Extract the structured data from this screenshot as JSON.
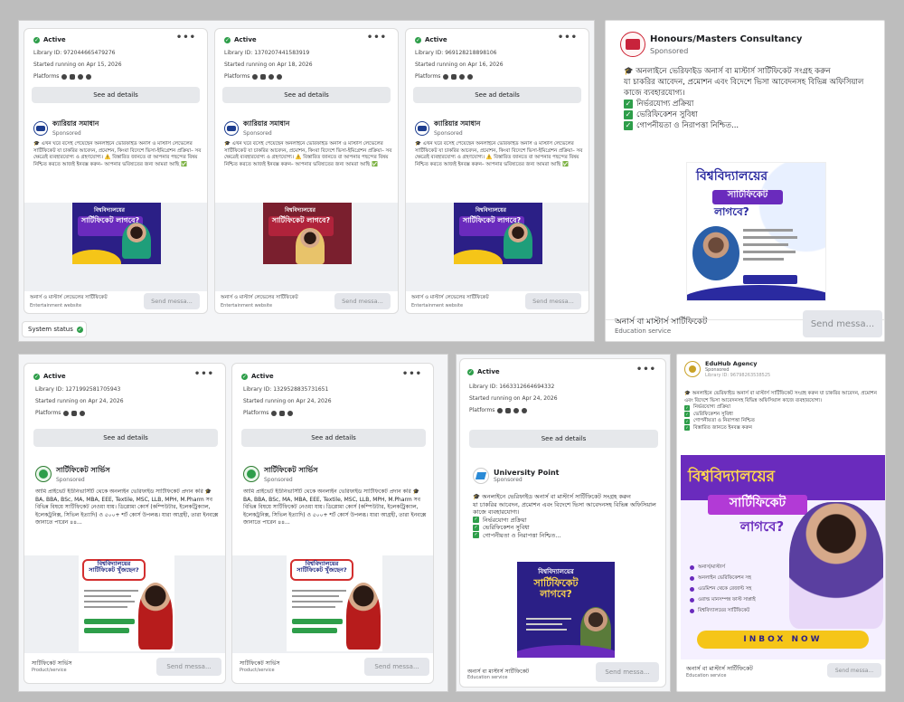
{
  "top_panel_cards": [
    {
      "status": "Active",
      "library_id": "Library ID: 972044665479276",
      "started": "Started running on Apr 15, 2026",
      "platforms_label": "Platforms",
      "see_details": "See ad details",
      "advertiser": "ক্যারিয়ার সমাধান",
      "sponsored": "Sponsored",
      "body": "🎓 এখন ঘরে বসেই পেয়েছেন অনলাইনে ভেরিফাইড অনার্স ও মাস্টার্স লেভেলের সার্টিফিকেট যা চাকরির আবেদন, প্রমোশন, কিংবা বিদেশে ভিসা-ইমিগ্রেশন প্রক্রিয়া– সব ক্ষেত্রেই ব্যবহারযোগ্য ও গ্রহণযোগ্য। ⚠️ বিস্তারিত জানতে বা আপনার পছন্দের বিষয় নিশ্চিত করতে আজই ইনবক্স করুন– আপনার ভবিষ্যতের জন্য আমরা আছি ✅",
      "creative_title": "সার্টিফিকেট লাগবে?",
      "creative_kicker": "বিশ্ববিদ্যালয়ের",
      "footer_label": "অনার্স ও মাস্টার্স লেভেলের সার্টিফিকেট",
      "footer_sub": "Entertainment website",
      "send": "Send messa..."
    },
    {
      "status": "Active",
      "library_id": "Library ID: 1370207441583919",
      "started": "Started running on Apr 18, 2026",
      "platforms_label": "Platforms",
      "see_details": "See ad details",
      "advertiser": "ক্যারিয়ার সমাধান",
      "sponsored": "Sponsored",
      "body": "🎓 এখন ঘরে বসেই পেয়েছেন অনলাইনে ভেরিফাইড অনার্স ও মাস্টার্স লেভেলের সার্টিফিকেট যা চাকরির আবেদন, প্রমোশন, কিংবা বিদেশে ভিসা-ইমিগ্রেশন প্রক্রিয়া– সব ক্ষেত্রেই ব্যবহারযোগ্য ও গ্রহণযোগ্য। ⚠️ বিস্তারিত জানতে বা আপনার পছন্দের বিষয় নিশ্চিত করতে আজই ইনবক্স করুন– আপনার ভবিষ্যতের জন্য আমরা আছি ✅",
      "creative_title": "সার্টিফিকেট লাগবে?",
      "creative_kicker": "বিশ্ববিদ্যালয়ের",
      "footer_label": "অনার্স ও মাস্টার্স লেভেলের সার্টিফিকেট",
      "footer_sub": "Entertainment website",
      "send": "Send messa..."
    },
    {
      "status": "Active",
      "library_id": "Library ID: 969128218898106",
      "started": "Started running on Apr 16, 2026",
      "platforms_label": "Platforms",
      "see_details": "See ad details",
      "advertiser": "ক্যারিয়ার সমাধান",
      "sponsored": "Sponsored",
      "body": "🎓 এখন ঘরে বসেই পেয়েছেন অনলাইনে ভেরিফাইড অনার্স ও মাস্টার্স লেভেলের সার্টিফিকেট যা চাকরির আবেদন, প্রমোশন, কিংবা বিদেশে ভিসা-ইমিগ্রেশন প্রক্রিয়া– সব ক্ষেত্রেই ব্যবহারযোগ্য ও গ্রহণযোগ্য। ⚠️ বিস্তারিত জানতে বা আপনার পছন্দের বিষয় নিশ্চিত করতে আজই ইনবক্স করুন– আপনার ভবিষ্যতের জন্য আমরা আছি ✅",
      "creative_title": "সার্টিফিকেট লাগবে?",
      "creative_kicker": "বিশ্ববিদ্যালয়ের",
      "footer_label": "অনার্স ও মাস্টার্স লেভেলের সার্টিফিকেট",
      "footer_sub": "Entertainment website",
      "send": "Send messa..."
    }
  ],
  "system_status": "System status",
  "large_ad": {
    "advertiser": "Honours/Masters Consultancy",
    "sponsored": "Sponsored",
    "body_line1": "🎓 অনলাইনে ভেরিফাইড অনার্স বা মাস্টার্স সার্টিফিকেট সংগ্রহ করুন",
    "body_line2": "যা চাকরির আবেদন, প্রমোশন এবং বিদেশে ভিসা আবেদনসহ বিভিন্ন অফিসিয়াল কাজে ব্যবহারযোগ্য।",
    "checks": [
      "নির্ভরযোগ্য প্রক্রিয়া",
      "ভেরিফিকেশন সুবিধা",
      "গোপনীয়তা ও নিরাপত্তা নিশ্চিত..."
    ],
    "creative_title1": "বিশ্ববিদ্যালয়ের",
    "creative_title2": "সার্টিফিকেট",
    "creative_title3": "লাগবে?",
    "footer_label": "অনার্স বা মাস্টার্স সার্টিফিকেট",
    "footer_sub": "Education service",
    "send": "Send messa..."
  },
  "bottom_cards": [
    {
      "status": "Active",
      "library_id": "Library ID: 1271992581705943",
      "started": "Started running on Apr 24, 2026",
      "platforms_label": "Platforms",
      "see_details": "See ad details",
      "advertiser": "সার্টিফিকেট সার্ভিস",
      "sponsored": "Sponsored",
      "body": "আমি প্রাইভেট ইউনিভার্সিটি থেকে অনলাইন ভেরিফাইড সার্টিফিকেট প্রদান করি 🎓 BA, BBA, BSc, MA, MBA, EEE, Textile, MSC, LLB, MPH, M.Pharm সব বিভিন্ন বিষয়ে সার্টিফিকেট নেওয়া যায়। ডিপ্লোমা কোর্স (কম্পিউটার, ইলেকট্রিক্যাল, ইলেকট্রনিক্স, সিভিল ইত্যাদি) ও ৫০০+ শর্ট কোর্স উপলব্ধ। যারা আগ্রহী, তারা ইনবক্সে জানাতে পারেন ৪৪...",
      "creative_title": "বিশ্ববিদ্যালয়ের সার্টিফিকেট খুঁজছেন?",
      "footer_label": "সার্টিফিকেট সার্ভিস",
      "footer_sub": "Product/service",
      "send": "Send messa..."
    },
    {
      "status": "Active",
      "library_id": "Library ID: 1329528835731651",
      "started": "Started running on Apr 24, 2026",
      "platforms_label": "Platforms",
      "see_details": "See ad details",
      "advertiser": "সার্টিফিকেট সার্ভিস",
      "sponsored": "Sponsored",
      "body": "আমি প্রাইভেট ইউনিভার্সিটি থেকে অনলাইন ভেরিফাইড সার্টিফিকেট প্রদান করি 🎓 BA, BBA, BSc, MA, MBA, EEE, Textile, MSC, LLB, MPH, M.Pharm সব বিভিন্ন বিষয়ে সার্টিফিকেট নেওয়া যায়। ডিপ্লোমা কোর্স (কম্পিউটার, ইলেকট্রিক্যাল, ইলেকট্রনিক্স, সিভিল ইত্যাদি) ও ৫০০+ শর্ট কোর্স উপলব্ধ। যারা আগ্রহী, তারা ইনবক্সে জানাতে পারেন ৪৪...",
      "creative_title": "বিশ্ববিদ্যালয়ের সার্টিফিকেট খুঁজছেন?",
      "footer_label": "সার্টিফিকেট সার্ভিস",
      "footer_sub": "Product/service",
      "send": "Send messa..."
    }
  ],
  "university_card": {
    "status": "Active",
    "library_id": "Library ID: 1663312664694332",
    "started": "Started running on Apr 24, 2026",
    "platforms_label": "Platforms",
    "see_details": "See ad details",
    "advertiser": "University Point",
    "sponsored": "Sponsored",
    "body_line1": "🎓 অনলাইনে ভেরিফাইড অনার্স বা মাস্টার্স সার্টিফিকেট সংগ্রহ করুন",
    "body_line2": "যা চাকরির আবেদন, প্রমোশন এবং বিদেশে ভিসা আবেদনসহ বিভিন্ন অফিসিয়াল কাজে ব্যবহারযোগ্য।",
    "checks": [
      "নির্ভরযোগ্য প্রক্রিয়া",
      "ভেরিফিকেশন সুবিধা",
      "গোপনীয়তা ও নিরাপত্তা নিশ্চিত..."
    ],
    "creative_kicker": "বিশ্ববিদ্যালয়ের",
    "creative_title": "সার্টিফিকেট লাগবে?",
    "footer_label": "অনার্স বা মাস্টার্স সার্টিফিকেট",
    "footer_sub": "Education service",
    "send": "Send messa..."
  },
  "eduhub_card": {
    "advertiser": "EduHub Agency",
    "sponsored": "Sponsored",
    "library_id": "Library ID: 96798263538525",
    "body_line1": "🎓 অনলাইনে ভেরিফাইড অনার্স বা মাস্টার্স সার্টিফিকেট সংগ্রহ করুন যা চাকরির আবেদন, প্রমোশন এবং বিদেশে ভিসা আবেদনসহ বিভিন্ন অফিসিয়াল কাজে ব্যবহারযোগ্য।",
    "checks": [
      "নির্ভরযোগ্য প্রক্রিয়া",
      "ভেরিফিকেশন সুবিধা",
      "গোপনীয়তা ও নিরাপত্তা নিশ্চিত",
      "বিস্তারিত জানতে ইনবক্স করুন"
    ],
    "creative_title1": "বিশ্ববিদ্যালয়ের",
    "creative_title2": "সার্টিফিকেট",
    "creative_title3": "লাগবে?",
    "creative_list": [
      "অনার্স/মাস্টার্স",
      "অনলাইন ভেরিফিকেশন সহ",
      "এডমিশন থেকে রেজাল্ট সহ",
      "ওরাল্ড মানসম্পন্ন ফাস্ট সাপ্লাই",
      "বিশ্ববিদ্যালয়ের সার্টিফিকেট"
    ],
    "inbox_now": "INBOX NOW",
    "footer_label": "অনার্স বা মাস্টার্স সার্টিফিকেট",
    "footer_sub": "Education service",
    "send": "Send messa..."
  },
  "colors": {
    "active_green": "#2e9e4a",
    "banner_blue": "#2b1f86",
    "banner_purple": "#6a2bbd",
    "banner_yellow": "#f5c518"
  }
}
